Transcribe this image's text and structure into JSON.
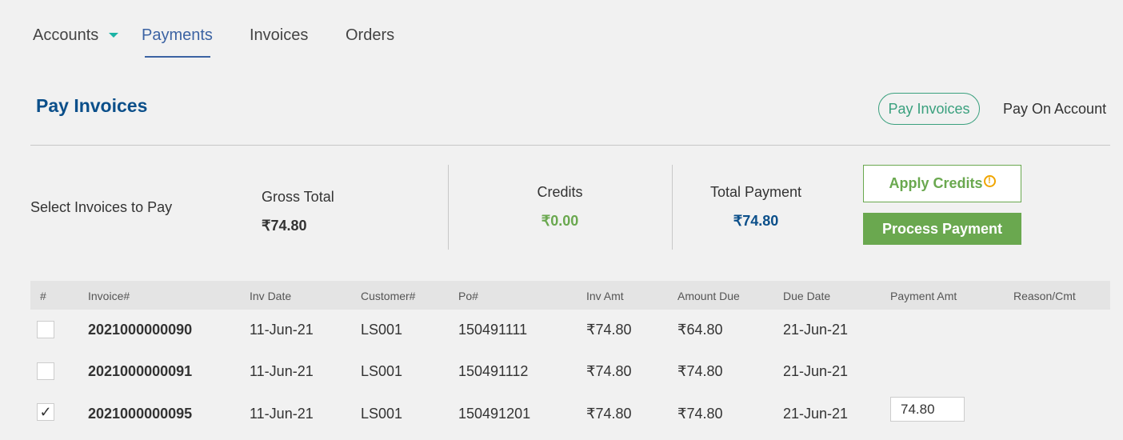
{
  "nav": {
    "accounts": "Accounts",
    "payments": "Payments",
    "invoices": "Invoices",
    "orders": "Orders"
  },
  "header": {
    "title": "Pay Invoices",
    "pill_active": "Pay Invoices",
    "pill_other": "Pay On Account"
  },
  "summary": {
    "select_label": "Select Invoices to Pay",
    "gross_total_label": "Gross Total",
    "gross_total_value": "₹74.80",
    "credits_label": "Credits",
    "credits_value": "₹0.00",
    "total_payment_label": "Total Payment",
    "total_payment_value": "₹74.80",
    "apply_credits": "Apply Credits",
    "process_payment": "Process Payment"
  },
  "table": {
    "headers": [
      "#",
      "Invoice#",
      "Inv Date",
      "Customer#",
      "Po#",
      "Inv Amt",
      "Amount Due",
      "Due Date",
      "Payment Amt",
      "Reason/Cmt"
    ],
    "rows": [
      {
        "checked": false,
        "invoice": "2021000000090",
        "inv_date": "11-Jun-21",
        "customer": "LS001",
        "po": "150491111",
        "inv_amt": "₹74.80",
        "amount_due": "₹64.80",
        "due_date": "21-Jun-21",
        "payment_amt": ""
      },
      {
        "checked": false,
        "invoice": "2021000000091",
        "inv_date": "11-Jun-21",
        "customer": "LS001",
        "po": "150491112",
        "inv_amt": "₹74.80",
        "amount_due": "₹74.80",
        "due_date": "21-Jun-21",
        "payment_amt": ""
      },
      {
        "checked": true,
        "invoice": "2021000000095",
        "inv_date": "11-Jun-21",
        "customer": "LS001",
        "po": "150491201",
        "inv_amt": "₹74.80",
        "amount_due": "₹74.80",
        "due_date": "21-Jun-21",
        "payment_amt": "74.80"
      }
    ]
  },
  "colors": {
    "brand_blue": "#0b4f8a",
    "accent_green": "#6aa84f",
    "teal": "#3aa07e",
    "caret_teal": "#1bb3a5",
    "warning": "#f0a500"
  },
  "icons": {
    "accounts_caret": "caret-down-icon",
    "apply_credits_warning": "warning-circle-icon"
  }
}
